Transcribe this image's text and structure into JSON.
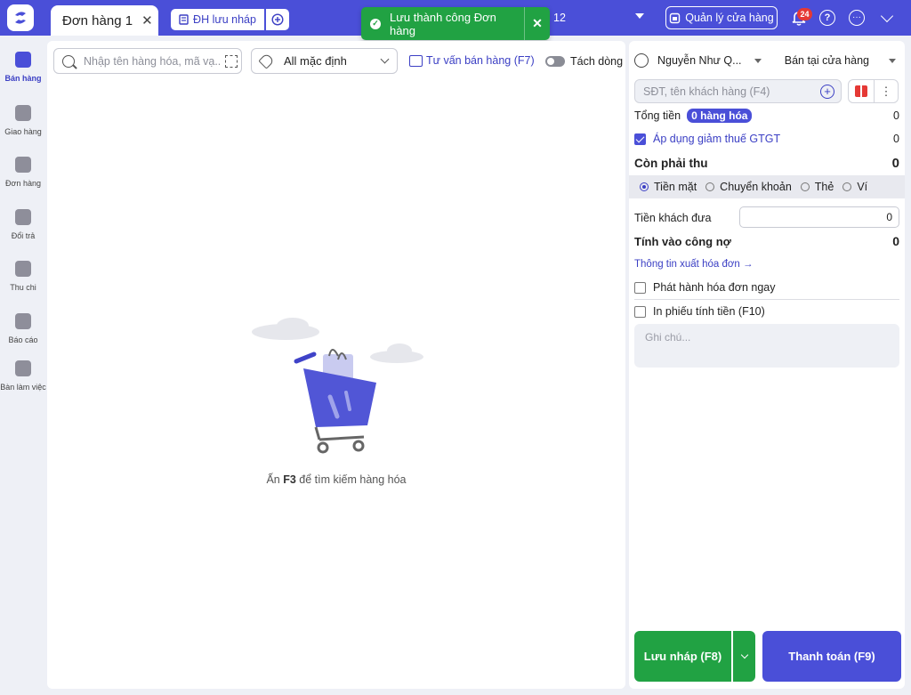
{
  "topbar": {
    "tab_label": "Đơn hàng 1",
    "tab_close": "✕",
    "draft_label": "ĐH lưu nháp",
    "number": "12",
    "store_label": "Quản lý cửa hàng",
    "notification_count": "24",
    "help": "?",
    "more": "···"
  },
  "toast": {
    "message": "Lưu thành công Đơn hàng",
    "close": "✕"
  },
  "sidebar": {
    "items": [
      {
        "label": "Bán hàng",
        "icon": "cart-icon"
      },
      {
        "label": "Giao hàng",
        "icon": "truck-icon"
      },
      {
        "label": "Đơn hàng",
        "icon": "document-icon"
      },
      {
        "label": "Đổi trả",
        "icon": "return-icon"
      },
      {
        "label": "Thu chi",
        "icon": "money-icon"
      },
      {
        "label": "Báo cáo",
        "icon": "report-icon"
      },
      {
        "label": "Bàn làm việc",
        "icon": "workspace-icon"
      }
    ]
  },
  "main": {
    "search_placeholder": "Nhập tên hàng hóa, mã vạ...",
    "filter_value": "All mặc định",
    "advise_label": "Tư vấn bán hàng (F7)",
    "split_label": "Tách dòng",
    "empty_prefix": "Ấn ",
    "empty_key": "F3",
    "empty_suffix": " để tìm kiếm hàng hóa"
  },
  "order": {
    "staff": "Nguyễn Như Q...",
    "channel": "Bán tại cửa hàng",
    "customer_placeholder": "SĐT, tên khách hàng (F4)",
    "total_label": "Tổng tiền",
    "items_pill": "0 hàng hóa",
    "total_value": "0",
    "vat_label": "Áp dụng giảm thuế GTGT",
    "vat_value": "0",
    "due_label": "Còn phải thu",
    "due_value": "0",
    "payment_methods": [
      "Tiền mặt",
      "Chuyển khoản",
      "Thẻ",
      "Ví"
    ],
    "cash_label": "Tiền khách đưa",
    "cash_value": "0",
    "debt_label": "Tính vào công nợ",
    "debt_value": "0",
    "invoice_link": "Thông tin xuất hóa đơn →",
    "issue_invoice_label": "Phát hành hóa đơn ngay",
    "print_label": "In phiếu tính tiền (F10)",
    "note_placeholder": "Ghi chú...",
    "save_draft_label": "Lưu nháp (F8)",
    "pay_label": "Thanh toán (F9)"
  },
  "colors": {
    "brand": "#4a4fd8",
    "success": "#21a243",
    "danger": "#e53935"
  }
}
